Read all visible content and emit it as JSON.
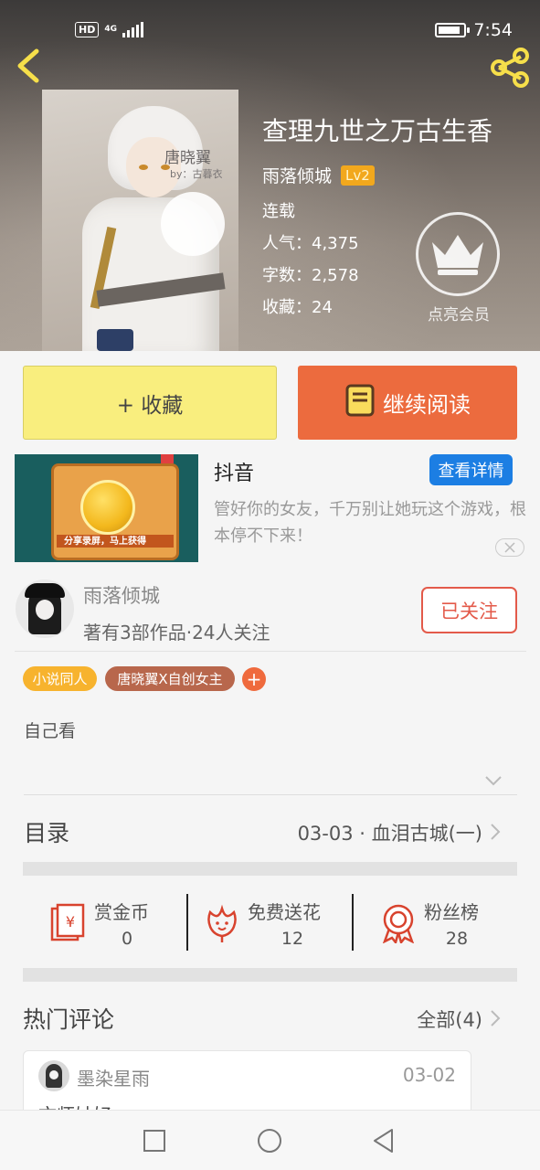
{
  "status_bar": {
    "network_badge": "HD",
    "network_type": "4G",
    "time": "7:54",
    "battery_level": 0.9
  },
  "book": {
    "cover_title": "唐晓翼",
    "cover_subtitle": "by：古暮衣",
    "title": "查理九世之万古生香",
    "author": "雨落倾城",
    "level": "Lv2",
    "status": "连载",
    "popularity": "人气：4,375",
    "word_count": "字数：2,578",
    "favorites": "收藏：24"
  },
  "vip": {
    "label": "点亮会员"
  },
  "actions": {
    "collect_label": "+ 收藏",
    "read_label": "继续阅读"
  },
  "ad": {
    "title": "抖音",
    "detail_button": "查看详情",
    "description": "管好你的女友，千万别让她玩这个游戏，根本停不下来！",
    "image_caption": "分享录屏，马上获得"
  },
  "author_card": {
    "name": "雨落倾城",
    "meta": "著有3部作品·24人关注",
    "follow_label": "已关注"
  },
  "tags": [
    "小说同人",
    "唐晓翼X自创女主"
  ],
  "tag_add": "+",
  "synopsis": "自己看",
  "toc": {
    "label": "目录",
    "latest_chapter": "03-03 · 血泪古城(一)"
  },
  "rewards": [
    {
      "label": "赏金币",
      "value": "0",
      "icon": "red-envelope-icon"
    },
    {
      "label": "免费送花",
      "value": "12",
      "icon": "flower-icon"
    },
    {
      "label": "粉丝榜",
      "value": "28",
      "icon": "medal-icon"
    }
  ],
  "hot_comments": {
    "label": "热门评论",
    "all_label": "全部(4)",
    "items": [
      {
        "user": "墨染星雨",
        "date": "03-02",
        "text": "文师姑好"
      }
    ]
  },
  "colors": {
    "accent_orange": "#ec6b3e",
    "collect_yellow": "#f9ee7e",
    "follow_red": "#e35a4a",
    "ad_blue": "#1c7ee3",
    "icon_red": "#d8432e"
  }
}
